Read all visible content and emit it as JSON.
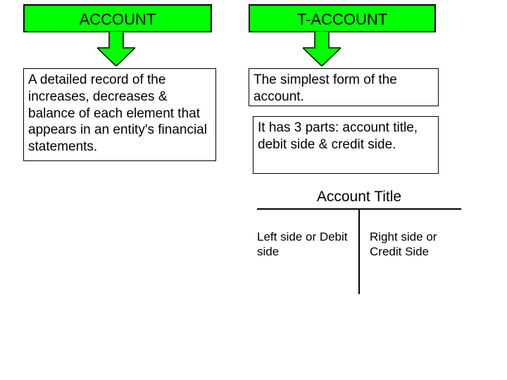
{
  "headers": {
    "left": "ACCOUNT",
    "right": "T-ACCOUNT"
  },
  "descriptions": {
    "account": "A detailed record of the increases, decreases & balance of each element that appears in an entity's financial statements.",
    "taccount1": "The simplest form of the account.",
    "taccount2": "It has 3 parts: account title, debit side & credit side."
  },
  "taccount_diagram": {
    "title": "Account Title",
    "left_label": "Left side or Debit side",
    "right_label": "Right side or Credit Side"
  },
  "colors": {
    "header_bg": "#00ff00"
  }
}
